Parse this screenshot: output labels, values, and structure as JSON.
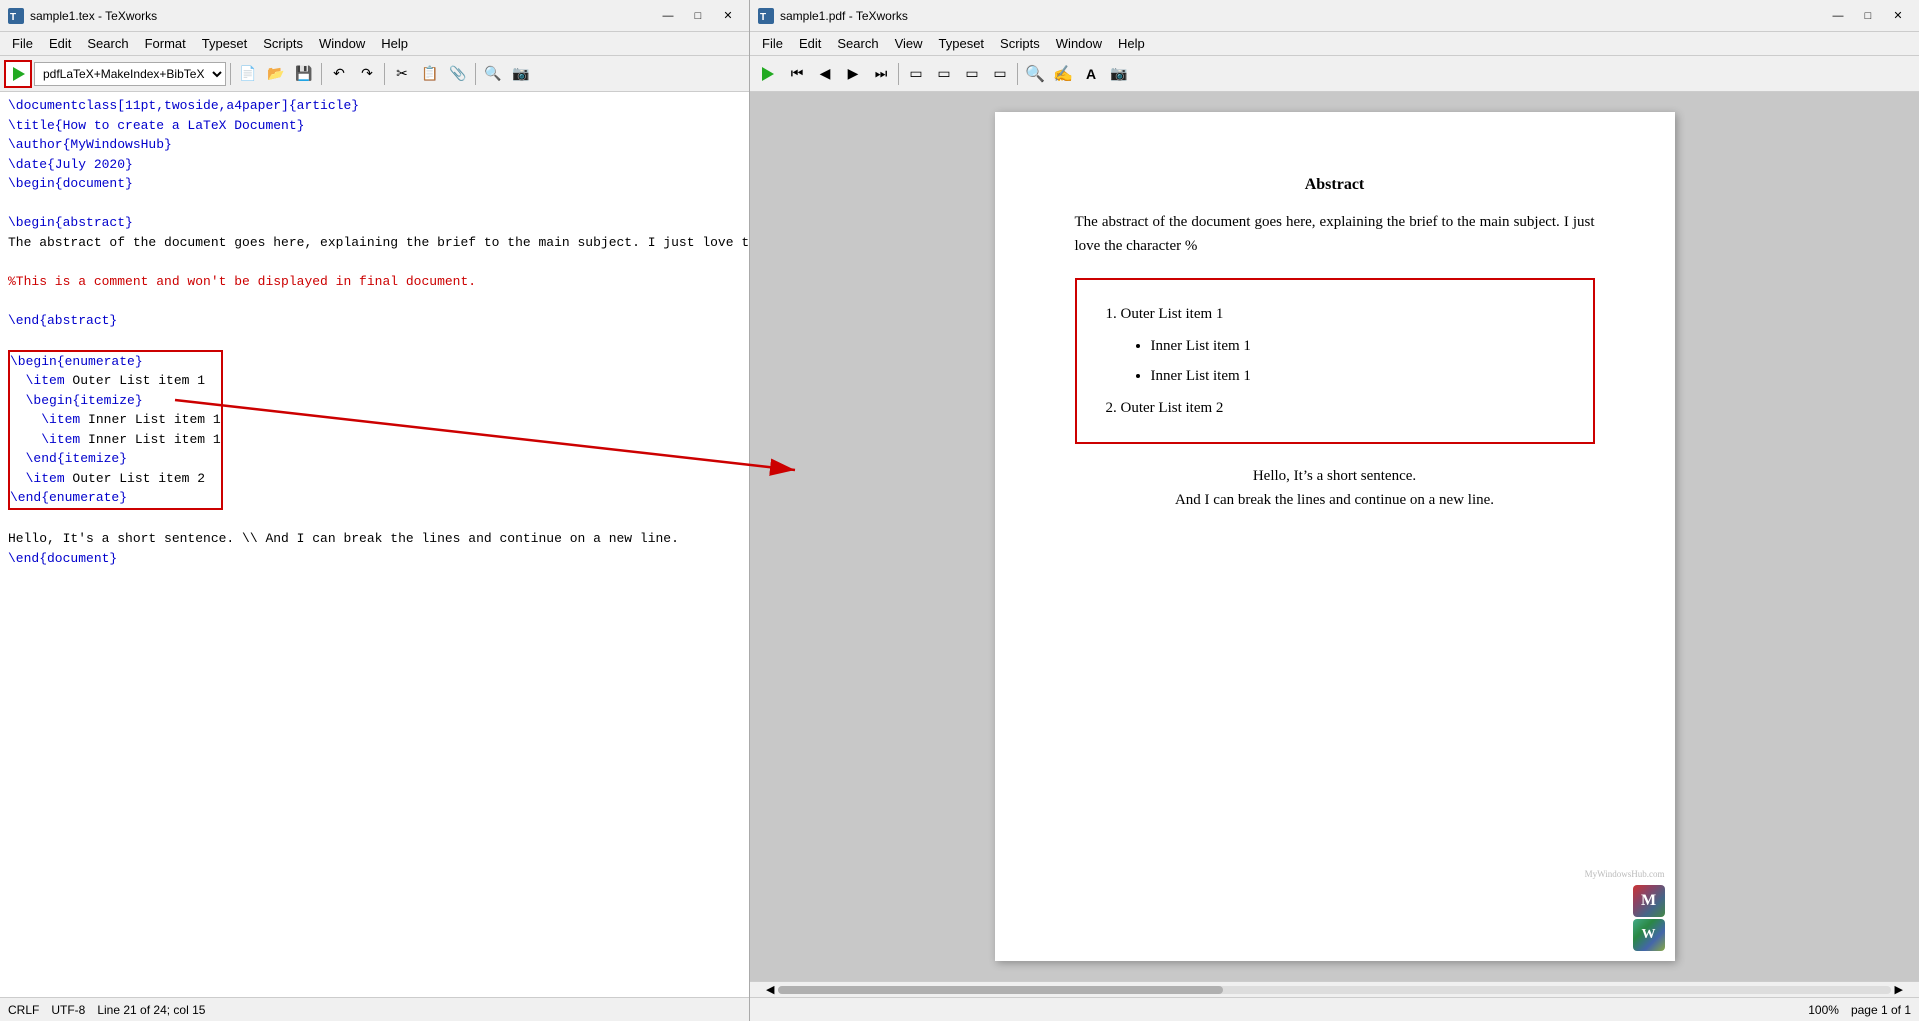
{
  "left": {
    "title": "sample1.tex - TeXworks",
    "menus": [
      "File",
      "Edit",
      "Search",
      "Format",
      "Typeset",
      "Scripts",
      "Window",
      "Help"
    ],
    "compiler": "pdfLaTeX+MakeIndex+BibTeX",
    "editor_lines": [
      {
        "type": "blue",
        "text": "\\documentclass[11pt,twoside,a4paper]{article}"
      },
      {
        "type": "blue",
        "text": "\\title{How to create a LaTeX Document}"
      },
      {
        "type": "blue",
        "text": "\\author{MyWindowsHub}"
      },
      {
        "type": "blue",
        "text": "\\date{July 2020}"
      },
      {
        "type": "blue",
        "text": "\\begin{document}"
      },
      {
        "type": "empty",
        "text": ""
      },
      {
        "type": "blue",
        "text": "\\begin{abstract}"
      },
      {
        "type": "black",
        "text": "The abstract of the document goes here, explaining the brief to the main subject. I just love the character "
      },
      {
        "type": "comment",
        "text": "%This is a comment and won't be displayed in final document."
      },
      {
        "type": "empty",
        "text": ""
      },
      {
        "type": "blue",
        "text": "\\end{abstract}"
      },
      {
        "type": "empty",
        "text": ""
      },
      {
        "type": "highlight_blue",
        "text": "\\begin{enumerate}"
      },
      {
        "type": "highlight_blue",
        "text": "  \\item Outer List item 1"
      },
      {
        "type": "highlight_blue",
        "text": "  \\begin{itemize}"
      },
      {
        "type": "highlight_blue",
        "text": "    \\item Inner List item 1"
      },
      {
        "type": "highlight_blue",
        "text": "    \\item Inner List item 1"
      },
      {
        "type": "highlight_blue",
        "text": "  \\end{itemize}"
      },
      {
        "type": "highlight_blue",
        "text": "  \\item Outer List item 2"
      },
      {
        "type": "highlight_blue",
        "text": "\\end{enumerate}"
      },
      {
        "type": "empty",
        "text": ""
      },
      {
        "type": "black",
        "text": "Hello, It's a short sentence. \\\\ And I can break the lines and continue on a new line."
      },
      {
        "type": "blue",
        "text": "\\end{document}"
      }
    ],
    "status": {
      "line_ending": "CRLF",
      "encoding": "UTF-8",
      "position": "Line 21 of 24; col 15"
    }
  },
  "right": {
    "title": "sample1.pdf - TeXworks",
    "menus": [
      "File",
      "Edit",
      "Search",
      "View",
      "Typeset",
      "Scripts",
      "Window",
      "Help"
    ],
    "pdf": {
      "abstract_title": "Abstract",
      "abstract_text": "The abstract of the document goes here, explaining the brief to the main subject. I just love the character %",
      "list": {
        "outer1": "Outer List item 1",
        "inner1": "Inner List item 1",
        "inner2": "Inner List item 1",
        "outer2": "Outer List item 2"
      },
      "closing1": "Hello, It’s a short sentence.",
      "closing2": "And I can break the lines and continue on a new line."
    },
    "status": {
      "zoom": "100%",
      "page": "page 1 of 1"
    }
  },
  "icons": {
    "run": "▶",
    "rewind": "⏮",
    "back": "◄",
    "forward": "►",
    "fast_forward": "⏭",
    "new": "📄",
    "open": "📂",
    "save": "💾",
    "undo": "↶",
    "redo": "↷",
    "cut": "✂",
    "copy": "📋",
    "paste": "📎",
    "find": "🔍",
    "zoom_in": "🔍",
    "hand": "✋",
    "text": "A",
    "screenshot": "📷"
  }
}
